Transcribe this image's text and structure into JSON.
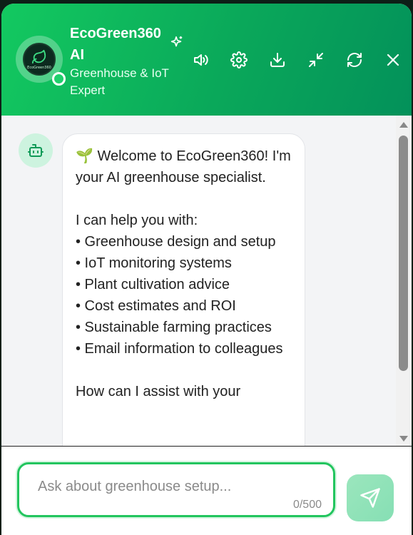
{
  "header": {
    "title": "EcoGreen360 AI",
    "subtitle": "Greenhouse & IoT Expert",
    "avatar_logo_text": "EcoGreen360",
    "icons": {
      "sparkle": "sparkles-icon",
      "sound": "volume-icon",
      "settings": "gear-icon",
      "download": "download-icon",
      "minimize": "minimize-icon",
      "refresh": "refresh-icon",
      "close": "close-icon"
    }
  },
  "messages": [
    {
      "sender": "bot",
      "icon": "bot-icon",
      "text": "🌱 Welcome to EcoGreen360! I'm your AI greenhouse specialist.\n\nI can help you with:\n• Greenhouse design and setup\n• IoT monitoring systems\n• Plant cultivation advice\n• Cost estimates and ROI\n• Sustainable farming practices\n• Email information to colleagues\n\nHow can I assist with your"
    }
  ],
  "composer": {
    "placeholder": "Ask about greenhouse setup...",
    "value": "",
    "counter": "0/500",
    "send_icon": "send-icon"
  },
  "colors": {
    "header_start": "#13c960",
    "header_end": "#03915a",
    "accent": "#22c55e",
    "send_button": "#8fe2b8"
  }
}
